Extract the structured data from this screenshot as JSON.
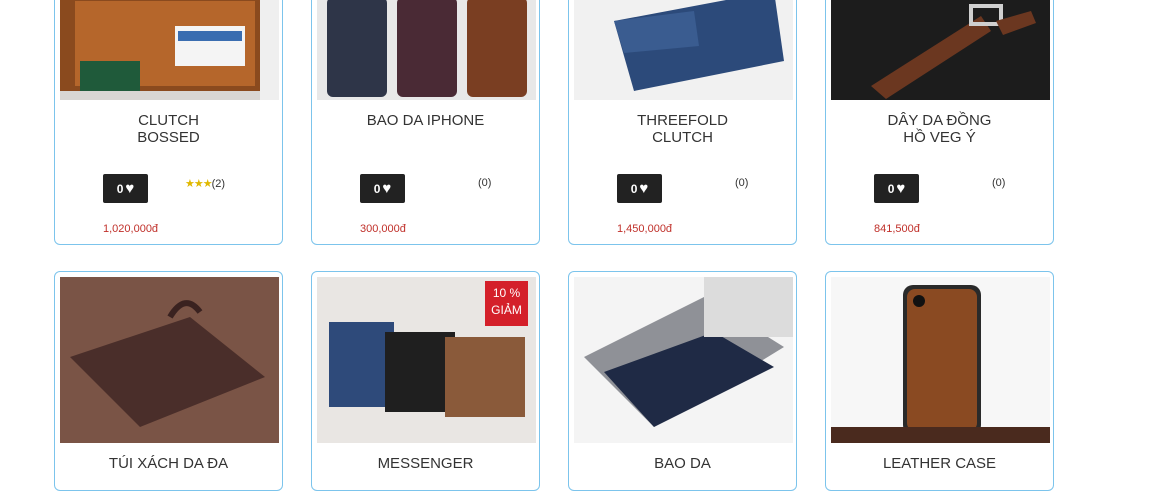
{
  "products": [
    {
      "title_line1": "CLUTCH",
      "title_line2": "BOSSED",
      "likes": "0",
      "stars": "★★★",
      "rating_count": "(2)",
      "price": "1,020,000đ"
    },
    {
      "title_line1": "BAO DA IPHONE",
      "title_line2": "",
      "likes": "0",
      "stars": "",
      "rating_count": "(0)",
      "price": "300,000đ"
    },
    {
      "title_line1": "THREEFOLD",
      "title_line2": "CLUTCH",
      "likes": "0",
      "stars": "",
      "rating_count": "(0)",
      "price": "1,450,000đ"
    },
    {
      "title_line1": "DÂY DA ĐỒNG",
      "title_line2": "HỒ VEG Ý",
      "likes": "0",
      "stars": "",
      "rating_count": "(0)",
      "price": "841,500đ"
    },
    {
      "title_line1": "TÚI XÁCH DA ĐA",
      "title_line2": ""
    },
    {
      "title_line1": "MESSENGER",
      "title_line2": "",
      "sale_line1": "10 %",
      "sale_line2": "GIẢM"
    },
    {
      "title_line1": "BAO DA",
      "title_line2": ""
    },
    {
      "title_line1": "LEATHER CASE",
      "title_line2": ""
    }
  ],
  "heart_icon": "♥"
}
